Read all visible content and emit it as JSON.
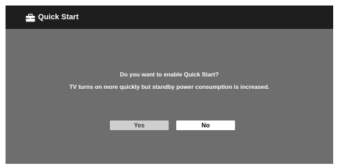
{
  "dialog": {
    "title": "Quick Start",
    "title_icon": "toolbox-icon",
    "message_line_1": "Do you want to enable Quick Start?",
    "message_line_2": "TV turns on more quickly but standby power consumption is increased.",
    "buttons": {
      "yes_label": "Yes",
      "no_label": "No"
    }
  },
  "colors": {
    "title_bar": "#1e1e1e",
    "background": "#6e6e6e",
    "button_selected_off": "#cfcfcf",
    "button_highlighted": "#ffffff",
    "text": "#ffffff"
  }
}
